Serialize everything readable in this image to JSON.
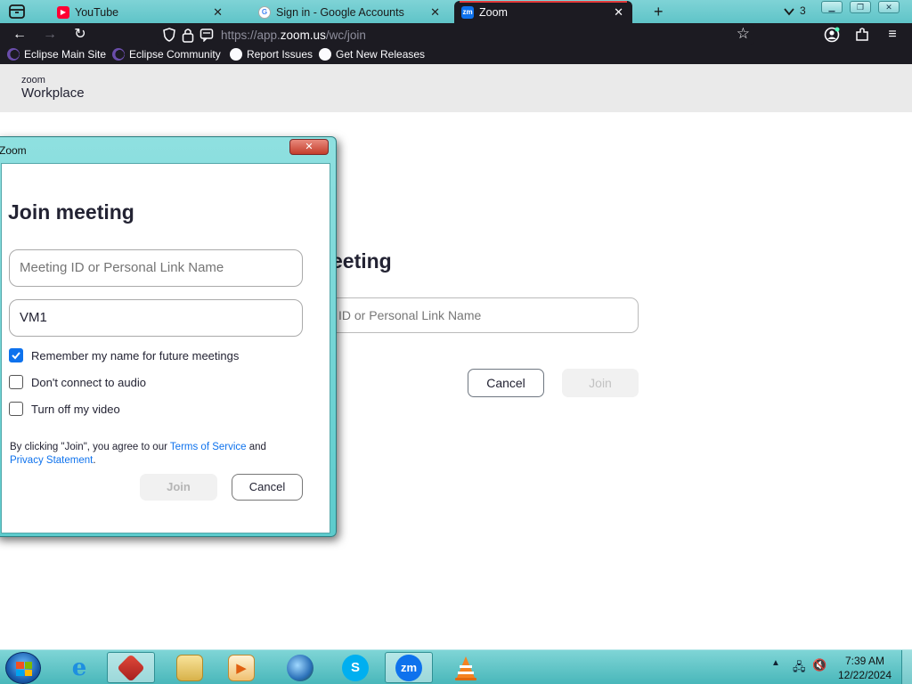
{
  "browser": {
    "tabs": [
      {
        "label": "YouTube",
        "favicon": "youtube-icon"
      },
      {
        "label": "Sign in - Google Accounts",
        "favicon": "google-icon"
      },
      {
        "label": "Zoom",
        "favicon": "zoom-icon",
        "active": true
      }
    ],
    "tab_count": "3",
    "url_prefix": "https://app.",
    "url_domain": "zoom.us",
    "url_path": "/wc/join",
    "bookmarks": [
      "Eclipse Main Site",
      "Eclipse Community",
      "Report Issues",
      "Get New Releases"
    ]
  },
  "page": {
    "logo_top": "zoom",
    "logo_bottom": "Workplace",
    "title_fragment": "eeting",
    "input_placeholder_fragment": "ID or Personal Link Name",
    "cancel_label": "Cancel",
    "join_label": "Join"
  },
  "dialog": {
    "window_title": "Zoom",
    "close_glyph": "✕",
    "heading": "Join meeting",
    "meeting_id_placeholder": "Meeting ID or Personal Link Name",
    "name_value": "VM1",
    "options": [
      {
        "label": "Remember my name for future meetings",
        "checked": true
      },
      {
        "label": "Don't connect to audio",
        "checked": false
      },
      {
        "label": "Turn off my video",
        "checked": false
      }
    ],
    "legal_prefix": "By clicking \"Join\", you agree to our ",
    "terms_link": "Terms of Service",
    "legal_and": " and",
    "privacy_link": "Privacy Statement",
    "legal_suffix": ".",
    "join_label": "Join",
    "cancel_label": "Cancel"
  },
  "taskbar": {
    "apps": [
      "internet-explorer",
      "gallery-app",
      "file-explorer",
      "media-player",
      "browser-globe",
      "skype",
      "zoom",
      "vlc"
    ],
    "zoom_badge": "zm",
    "skype_badge": "S",
    "time": "7:39 AM",
    "date": "12/22/2024"
  },
  "colors": {
    "zoom_blue": "#0e72ed",
    "aero_teal": "#5fc4c8",
    "browser_dark": "#1c1b22"
  }
}
